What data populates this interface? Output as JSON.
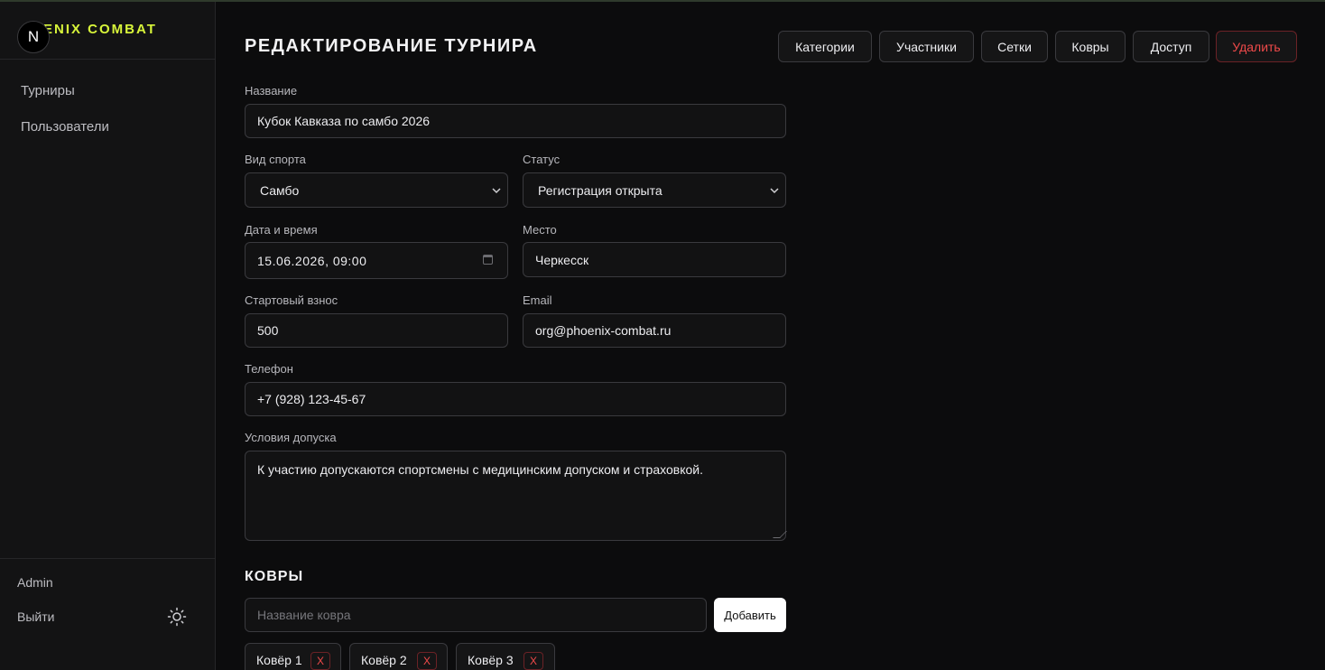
{
  "brand": {
    "name": "ENIX COMBAT",
    "logo_letter": "N"
  },
  "sidebar": {
    "items": [
      {
        "label": "Турниры"
      },
      {
        "label": "Пользователи"
      }
    ],
    "user": "Admin",
    "logout": "Выйти"
  },
  "header": {
    "title": "РЕДАКТИРОВАНИЕ ТУРНИРА",
    "buttons": {
      "categories": "Категории",
      "participants": "Участники",
      "brackets": "Сетки",
      "mats": "Ковры",
      "access": "Доступ",
      "delete": "Удалить"
    }
  },
  "form": {
    "name_label": "Название",
    "name_value": "Кубок Кавказа по самбо 2026",
    "sport_label": "Вид спорта",
    "sport_value": "Самбо",
    "status_label": "Статус",
    "status_value": "Регистрация открыта",
    "datetime_label": "Дата и время",
    "datetime_value": "15.06.2026, 09:00",
    "place_label": "Место",
    "place_value": "Черкесск",
    "fee_label": "Стартовый взнос",
    "fee_value": "500",
    "email_label": "Email",
    "email_value": "org@phoenix-combat.ru",
    "phone_label": "Телефон",
    "phone_value": "+7 (928) 123-45-67",
    "conditions_label": "Условия допуска",
    "conditions_value": "К участию допускаются спортсмены с медицинским допуском и страховкой."
  },
  "mats": {
    "title": "КОВРЫ",
    "input_placeholder": "Название ковра",
    "add_label": "Добавить",
    "items": [
      {
        "name": "Ковёр 1"
      },
      {
        "name": "Ковёр 2"
      },
      {
        "name": "Ковёр 3"
      }
    ],
    "remove_label": "X"
  },
  "colors": {
    "accent": "#d8f53a",
    "danger": "#f04a4a",
    "background": "#0c0c0d",
    "sidebar": "#131314"
  },
  "icons": {
    "theme": "sun-icon",
    "select": "chevron-down-icon",
    "date": "calendar-icon"
  }
}
